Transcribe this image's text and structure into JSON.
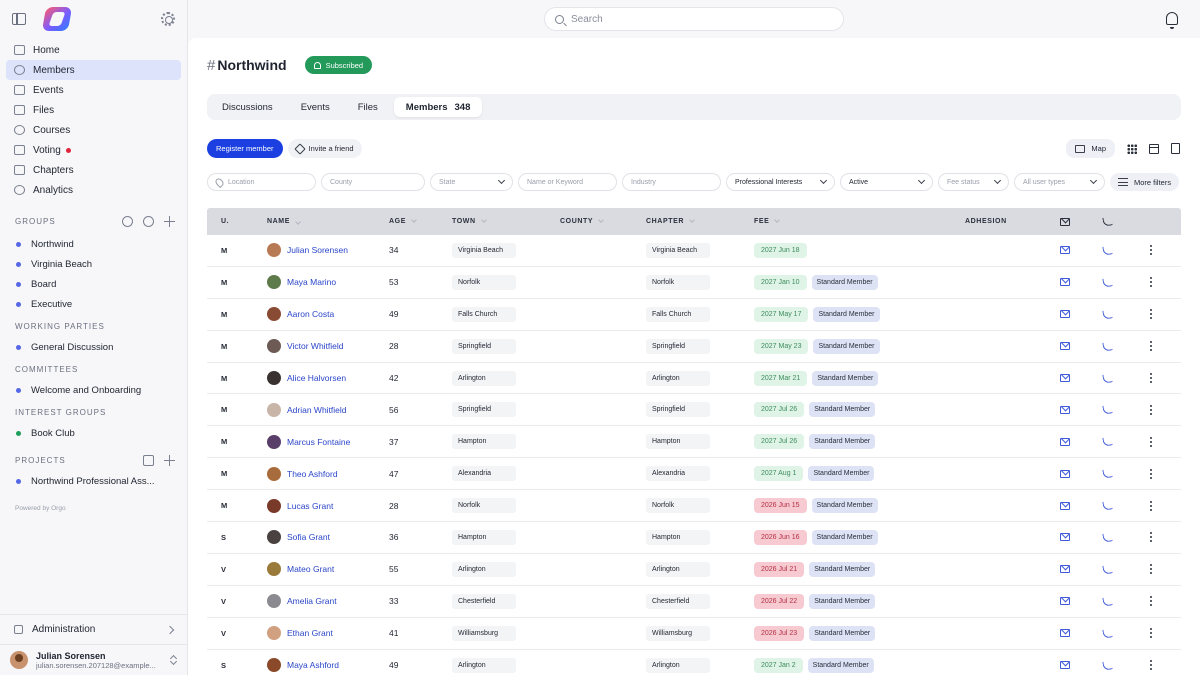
{
  "sidebar": {
    "nav": [
      {
        "label": "Home",
        "icon": "home-icon"
      },
      {
        "label": "Members",
        "icon": "members-icon",
        "active": true
      },
      {
        "label": "Events",
        "icon": "calendar-icon"
      },
      {
        "label": "Files",
        "icon": "files-icon"
      },
      {
        "label": "Courses",
        "icon": "book-icon"
      },
      {
        "label": "Voting",
        "icon": "vote-icon"
      },
      {
        "label": "Chapters",
        "icon": "chapters-icon"
      },
      {
        "label": "Analytics",
        "icon": "analytics-icon"
      }
    ],
    "groups_title": "GROUPS",
    "groups": [
      "Northwind",
      "Virginia Beach",
      "Board",
      "Executive"
    ],
    "working_title": "WORKING PARTIES",
    "working": [
      "General Discussion"
    ],
    "committees_title": "COMMITTEES",
    "committees": [
      "Welcome and Onboarding"
    ],
    "interest_title": "INTEREST GROUPS",
    "interest": [
      "Book Club"
    ],
    "projects_title": "PROJECTS",
    "projects": [
      "Northwind Professional Ass..."
    ],
    "powered": "Powered by Orgo",
    "admin": "Administration",
    "user_name": "Julian Sorensen",
    "user_email": "julian.sorensen.207128@example..."
  },
  "search": {
    "placeholder": "Search"
  },
  "page": {
    "title": "Northwind",
    "subscribed": "Subscribed",
    "tabs": [
      {
        "label": "Discussions"
      },
      {
        "label": "Events"
      },
      {
        "label": "Files"
      },
      {
        "label": "Members",
        "count": "348",
        "active": true
      }
    ],
    "register_label": "Register member",
    "invite_label": "Invite a friend",
    "map_label": "Map"
  },
  "filters": {
    "location": "Location",
    "county": "County",
    "state": "State",
    "keyword": "Name or Keyword",
    "industry": "Industry",
    "interests": "Professional Interests",
    "status": "Active",
    "fee_status": "Fee status",
    "user_types": "All user types",
    "more": "More filters"
  },
  "table": {
    "headers": {
      "u": "U.",
      "name": "NAME",
      "age": "AGE",
      "town": "TOWN",
      "county": "COUNTY",
      "chapter": "CHAPTER",
      "fee": "FEE",
      "adhesion": "ADHESION"
    },
    "rows": [
      {
        "u": "M",
        "name": "Julian Sorensen",
        "age": "34",
        "town": "Virginia Beach",
        "chapter": "Virginia Beach",
        "fee": "2027 Jun 18",
        "fee_status": "green",
        "membership": "",
        "avatar": "#b87a55"
      },
      {
        "u": "M",
        "name": "Maya Marino",
        "age": "53",
        "town": "Norfolk",
        "chapter": "Norfolk",
        "fee": "2027 Jan 10",
        "fee_status": "green",
        "membership": "Standard Member",
        "avatar": "#5d7a4a"
      },
      {
        "u": "M",
        "name": "Aaron Costa",
        "age": "49",
        "town": "Falls Church",
        "chapter": "Falls Church",
        "fee": "2027 May 17",
        "fee_status": "green",
        "membership": "Standard Member",
        "avatar": "#8a4b35"
      },
      {
        "u": "M",
        "name": "Victor Whitfield",
        "age": "28",
        "town": "Springfield",
        "chapter": "Springfield",
        "fee": "2027 May 23",
        "fee_status": "green",
        "membership": "Standard Member",
        "avatar": "#6d5a55"
      },
      {
        "u": "M",
        "name": "Alice Halvorsen",
        "age": "42",
        "town": "Arlington",
        "chapter": "Arlington",
        "fee": "2027 Mar 21",
        "fee_status": "green",
        "membership": "Standard Member",
        "avatar": "#3a3230"
      },
      {
        "u": "M",
        "name": "Adrian Whitfield",
        "age": "56",
        "town": "Springfield",
        "chapter": "Springfield",
        "fee": "2027 Jul 26",
        "fee_status": "green",
        "membership": "Standard Member",
        "avatar": "#c9b5a8"
      },
      {
        "u": "M",
        "name": "Marcus Fontaine",
        "age": "37",
        "town": "Hampton",
        "chapter": "Hampton",
        "fee": "2027 Jul 26",
        "fee_status": "green",
        "membership": "Standard Member",
        "avatar": "#5a3e6a"
      },
      {
        "u": "M",
        "name": "Theo Ashford",
        "age": "47",
        "town": "Alexandria",
        "chapter": "Alexandria",
        "fee": "2027 Aug 1",
        "fee_status": "green",
        "membership": "Standard Member",
        "avatar": "#a86b3c"
      },
      {
        "u": "M",
        "name": "Lucas Grant",
        "age": "28",
        "town": "Norfolk",
        "chapter": "Norfolk",
        "fee": "2026 Jun 15",
        "fee_status": "red",
        "membership": "Standard Member",
        "avatar": "#7a3a2a"
      },
      {
        "u": "S",
        "name": "Sofia Grant",
        "age": "36",
        "town": "Hampton",
        "chapter": "Hampton",
        "fee": "2026 Jun 16",
        "fee_status": "red",
        "membership": "Standard Member",
        "avatar": "#4a4240"
      },
      {
        "u": "V",
        "name": "Mateo Grant",
        "age": "55",
        "town": "Arlington",
        "chapter": "Arlington",
        "fee": "2026 Jul 21",
        "fee_status": "red",
        "membership": "Standard Member",
        "avatar": "#9a7a3a"
      },
      {
        "u": "V",
        "name": "Amelia Grant",
        "age": "33",
        "town": "Chesterfield",
        "chapter": "Chesterfield",
        "fee": "2026 Jul 22",
        "fee_status": "red",
        "membership": "Standard Member",
        "avatar": "#8a8a90"
      },
      {
        "u": "V",
        "name": "Ethan Grant",
        "age": "41",
        "town": "Williamsburg",
        "chapter": "Williamsburg",
        "fee": "2026 Jul 23",
        "fee_status": "red",
        "membership": "Standard Member",
        "avatar": "#d0a080"
      },
      {
        "u": "S",
        "name": "Maya Ashford",
        "age": "49",
        "town": "Arlington",
        "chapter": "Arlington",
        "fee": "2027 Jan 2",
        "fee_status": "green",
        "membership": "Standard Member",
        "avatar": "#8a4a2a"
      }
    ]
  }
}
